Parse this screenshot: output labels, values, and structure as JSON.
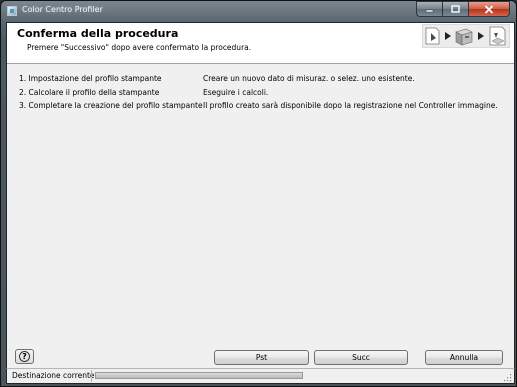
{
  "window": {
    "title": "Color Centro Profiler",
    "icon": "app-icon",
    "controls": {
      "minimize": "minimize-icon",
      "maximize": "maximize-icon",
      "close": "close-icon"
    }
  },
  "header": {
    "title": "Conferma della procedura",
    "subtitle": "Premere \"Successivo\" dopo avere confermato la procedura.",
    "graphic_icons": [
      "document-icon",
      "arrow-right-icon",
      "printer-icon",
      "arrow-right-icon",
      "profile-icon"
    ]
  },
  "steps": [
    {
      "name": "1. Impostazione del profilo stampante",
      "description": "Creare un nuovo dato di misuraz. o selez. uno esistente."
    },
    {
      "name": "2. Calcolare il profilo della stampante",
      "description": "Eseguire i calcoli."
    },
    {
      "name": "3. Completare la creazione del profilo stampante",
      "description": "Il profilo creato sarà disponibile dopo la registrazione nel Controller immagine."
    }
  ],
  "buttons": {
    "help_icon": "question-icon",
    "prev": "Pst",
    "next": "Succ",
    "cancel": "Annulla"
  },
  "status": {
    "label": "Destinazione corrente",
    "progress": 1.0
  },
  "colors": {
    "frame": "#4c5862",
    "client_bg": "#f0f0f0",
    "header_bg": "#ffffff",
    "close_button": "#c8402a"
  }
}
